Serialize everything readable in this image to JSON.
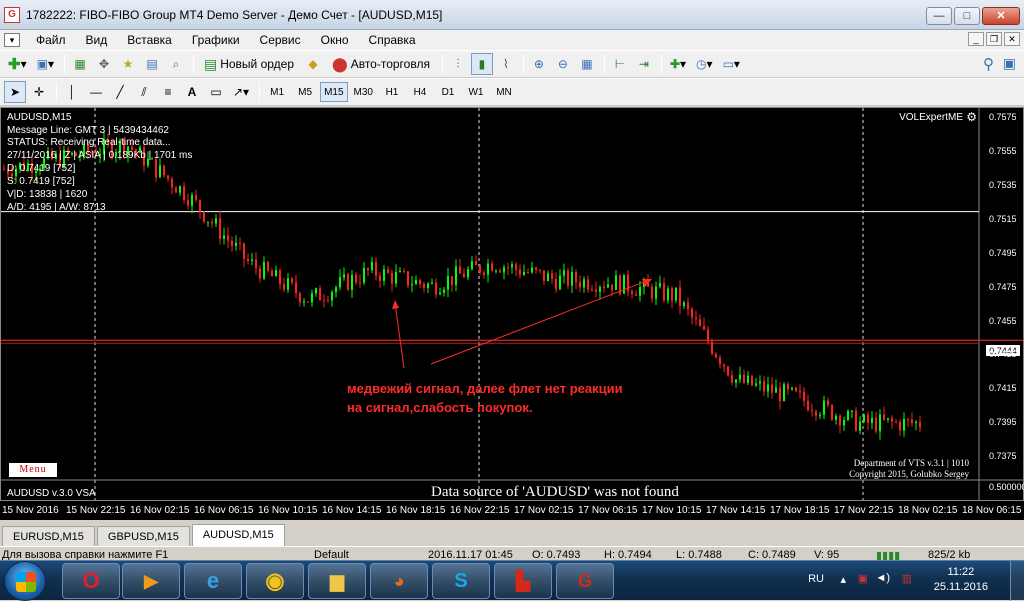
{
  "window": {
    "title": "1782222: FIBO-FIBO Group MT4 Demo Server - Демо Счет - [AUDUSD,M15]",
    "app_icon": "G"
  },
  "menu": [
    "Файл",
    "Вид",
    "Вставка",
    "Графики",
    "Сервис",
    "Окно",
    "Справка"
  ],
  "toolbar1": {
    "new_order": "Новый ордер",
    "autotrading": "Авто-торговля"
  },
  "timeframes": [
    "M1",
    "M5",
    "M15",
    "M30",
    "H1",
    "H4",
    "D1",
    "W1",
    "MN"
  ],
  "active_timeframe": "M15",
  "chart": {
    "title": "AUDUSD,M15",
    "indicator_name": "VOLExpertME",
    "status_lines": [
      "Message Line: GMT 3 | 5439434462",
      "STATUS:  Receiving Real-time data...",
      "27/11/2016 | Z | ASIA | 0.189Kb | 1701 ms",
      "D: 0.7419 [752]",
      "S: 0.7419  [752]",
      "V|D: 13838 | 1620",
      "A/D: 4195 | A/W: 8713"
    ],
    "menu_button": "Menu",
    "annotation": [
      "медвежий сигнал, далее флет нет реакции",
      "на сигнал,слабость покупок."
    ],
    "credits": [
      "Department of VTS  v.3.1 | 1010",
      "Copyright 2015, Golubko Sergey"
    ],
    "bottom_title": "AUDUSD v.3.0 VSA",
    "nodata_msg": "Data source of 'AUDUSD' was not found",
    "current_price": "0.7444",
    "price_labels": [
      "0.7575",
      "0.7555",
      "0.7535",
      "0.7515",
      "0.7495",
      "0.7475",
      "0.7455",
      "0.7435",
      "0.7415",
      "0.7395",
      "0.7375",
      "0.500000"
    ],
    "time_labels": [
      "15 Nov 2016",
      "15 Nov 22:15",
      "16 Nov 02:15",
      "16 Nov 06:15",
      "16 Nov 10:15",
      "16 Nov 14:15",
      "16 Nov 18:15",
      "16 Nov 22:15",
      "17 Nov 02:15",
      "17 Nov 06:15",
      "17 Nov 10:15",
      "17 Nov 14:15",
      "17 Nov 18:15",
      "17 Nov 22:15",
      "18 Nov 02:15",
      "18 Nov 06:15"
    ],
    "colors": {
      "bull": "#00ff00",
      "bear": "#ff2020",
      "red_line": "#ff3030",
      "white_line": "#ffffff",
      "annotation": "#ff2a2a"
    }
  },
  "chart_data": {
    "type": "line",
    "title": "",
    "xlabel": "",
    "ylabel": "",
    "ylim": [
      0.7365,
      0.758
    ],
    "x": [
      "15 Nov 2016",
      "15 Nov 22:15",
      "16 Nov 02:15",
      "16 Nov 06:15",
      "16 Nov 10:15",
      "16 Nov 14:15",
      "16 Nov 18:15",
      "16 Nov 22:15",
      "17 Nov 02:15",
      "17 Nov 06:15",
      "17 Nov 10:15",
      "17 Nov 14:15",
      "17 Nov 18:15",
      "17 Nov 22:15",
      "18 Nov 02:15",
      "18 Nov 06:15"
    ],
    "series": [
      {
        "values": [
          0.7545,
          0.7552,
          0.756,
          0.753,
          0.749,
          0.7468,
          0.7485,
          0.7476,
          0.749,
          0.748,
          0.7478,
          0.747,
          0.742,
          0.741,
          0.7395,
          0.7395
        ]
      }
    ],
    "hlines": [
      0.752,
      0.7444
    ],
    "grid": true
  },
  "tabs": [
    "EURUSD,M15",
    "GBPUSD,M15",
    "AUDUSD,M15"
  ],
  "active_tab": "AUDUSD,M15",
  "statusbar": {
    "help": "Для вызова справки нажмите F1",
    "profile": "Default",
    "datetime": "2016.11.17 01:45",
    "open": "O: 0.7493",
    "high": "H: 0.7494",
    "low": "L: 0.7488",
    "close": "C: 0.7489",
    "volume": "V: 95",
    "traffic": "825/2 kb"
  },
  "taskbar": {
    "lang": "RU",
    "time": "11:22",
    "date": "25.11.2016"
  }
}
